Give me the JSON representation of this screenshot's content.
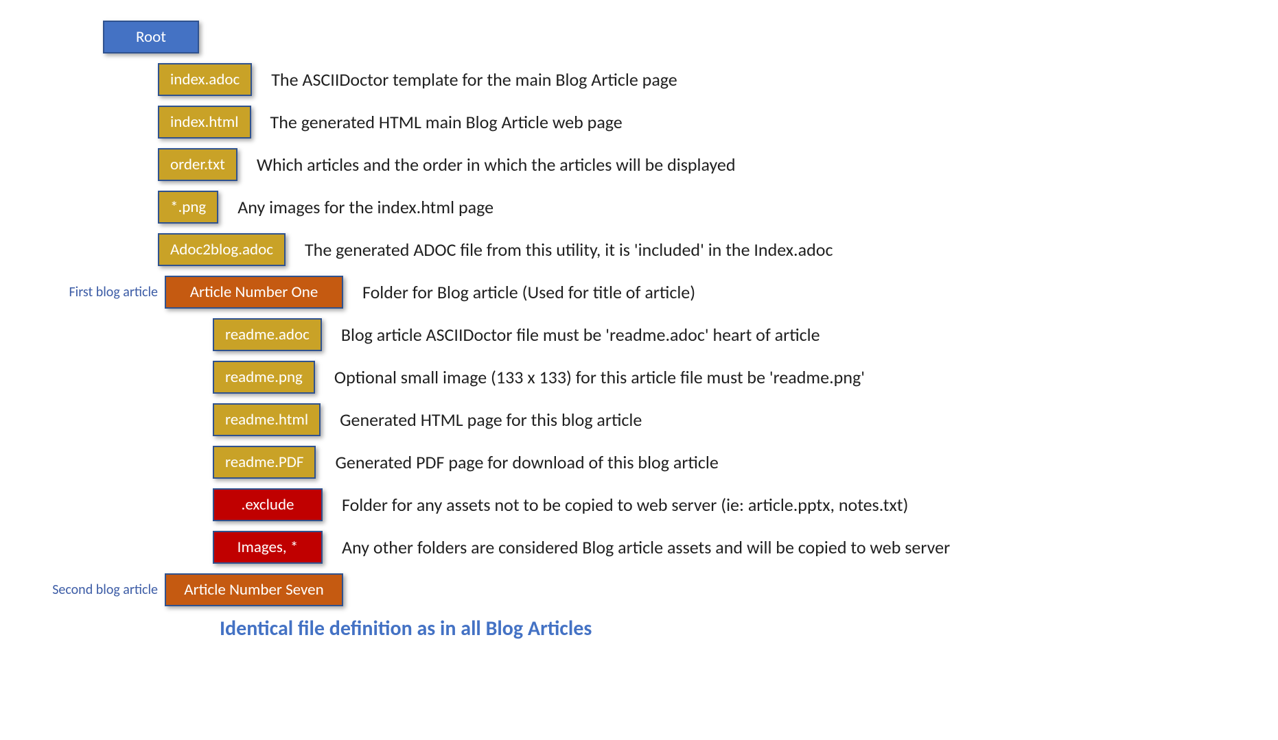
{
  "root": {
    "label": "Root"
  },
  "level1": [
    {
      "label": "index.adoc",
      "desc": "The ASCIIDoctor template for the main Blog Article page"
    },
    {
      "label": "index.html",
      "desc": "The generated HTML main Blog Article web page"
    },
    {
      "label": "order.txt",
      "desc": "Which articles and the order in which the articles will be displayed"
    },
    {
      "label": "*.png",
      "desc": "Any images for the index.html page"
    },
    {
      "label": "Adoc2blog.adoc",
      "desc": "The generated ADOC file from this utility, it is 'included' in the Index.adoc"
    }
  ],
  "article1": {
    "side": "First blog article",
    "label": "Article Number One",
    "desc": "Folder for Blog article (Used for title of article)"
  },
  "level3_gold": [
    {
      "label": "readme.adoc",
      "desc": "Blog article ASCIIDoctor file must be 'readme.adoc' heart of article"
    },
    {
      "label": "readme.png",
      "desc": "Optional small image (133 x 133) for this article file must be 'readme.png'"
    },
    {
      "label": "readme.html",
      "desc": "Generated HTML page for this blog article"
    },
    {
      "label": "readme.PDF",
      "desc": "Generated PDF page for download of this blog article"
    }
  ],
  "level3_red": [
    {
      "label": ".exclude",
      "desc": "Folder for any assets not to be copied to web server (ie: article.pptx, notes.txt)"
    },
    {
      "label": "Images, *",
      "desc": "Any other folders are considered Blog article assets and will be copied to web server"
    }
  ],
  "article2": {
    "side": "Second blog article",
    "label": "Article Number Seven"
  },
  "footer": "Identical file definition as in all Blog Articles"
}
